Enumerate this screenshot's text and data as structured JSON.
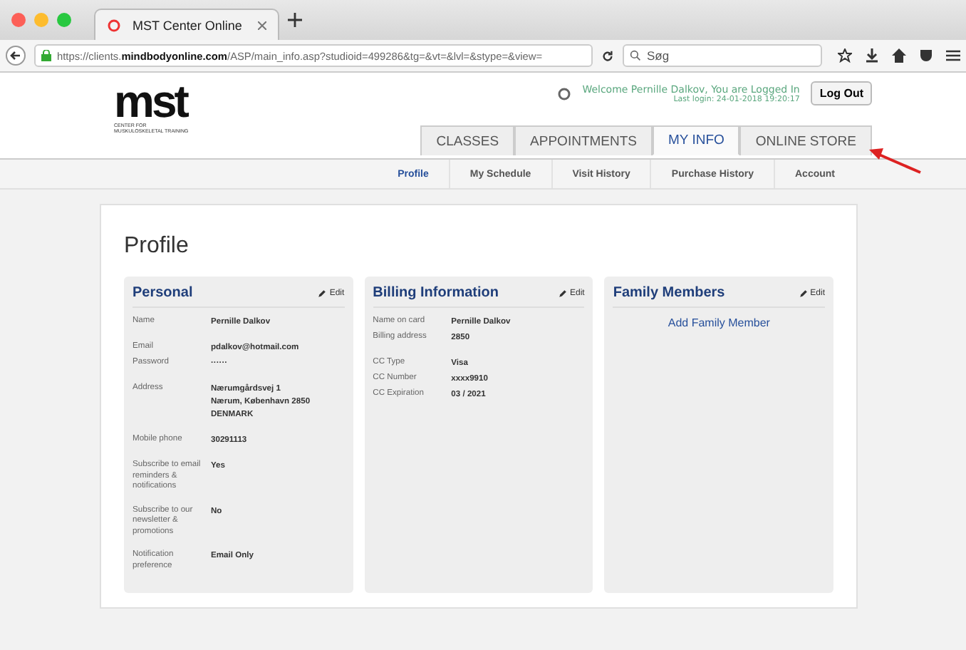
{
  "browser": {
    "tab_title": "MST Center Online",
    "url": "https://clients.**mindbodyonline.com**/ASP/main_info.asp?studioid=499286&tg=&vt=&lvl=&stype=&view=",
    "search_placeholder": "Søg"
  },
  "logo": {
    "mark": "mst",
    "line_1": "CENTER FOR",
    "line_2": "MUSKULOSKELETAL TRAINING"
  },
  "welcome": {
    "text": "Welcome Pernille Dalkov, You are Logged In",
    "last_login": "Last login: 24-01-2018 19:20:17",
    "logout": "Log Out"
  },
  "tabs": [
    {
      "label": "CLASSES",
      "selected": false
    },
    {
      "label": "APPOINTMENTS",
      "selected": false
    },
    {
      "label": "MY INFO",
      "selected": true
    },
    {
      "label": "ONLINE STORE",
      "selected": false
    }
  ],
  "subnav": [
    {
      "label": "Profile",
      "selected": true
    },
    {
      "label": "My Schedule",
      "selected": false
    },
    {
      "label": "Visit History",
      "selected": false
    },
    {
      "label": "Purchase History",
      "selected": false
    },
    {
      "label": "Account",
      "selected": false
    }
  ],
  "page_title": "Profile",
  "panels": [
    {
      "title": "Personal",
      "edit": "Edit",
      "groups": [
        [
          {
            "label": "Name",
            "value": [
              "Pernille Dalkov"
            ]
          }
        ],
        [
          {
            "label": "Email",
            "value": [
              "pdalkov@hotmail.com"
            ]
          },
          {
            "label": "Password",
            "value": [
              "······"
            ]
          }
        ],
        [
          {
            "label": "Address",
            "value": [
              "Nærumgårdsvej 1",
              "Nærum, København 2850",
              "DENMARK"
            ]
          }
        ],
        [
          {
            "label": "Mobile phone",
            "value": [
              "30291113"
            ]
          }
        ],
        [
          {
            "label": "Subscribe to email reminders & notifications",
            "value": [
              "Yes"
            ]
          }
        ],
        [
          {
            "label": "Subscribe to our newsletter & promotions",
            "value": [
              "No"
            ]
          }
        ],
        [
          {
            "label": "Notification preference",
            "value": [
              "Email Only"
            ]
          }
        ]
      ]
    },
    {
      "title": "Billing Information",
      "edit": "Edit",
      "groups": [
        [
          {
            "label": "Name on card",
            "value": [
              "Pernille Dalkov"
            ]
          },
          {
            "label": "Billing address",
            "value": [
              "2850"
            ]
          }
        ],
        [
          {
            "label": "CC Type",
            "value": [
              "Visa"
            ]
          },
          {
            "label": "CC Number",
            "value": [
              "xxxx9910"
            ]
          },
          {
            "label": "CC Expiration",
            "value": [
              "03 / 2021"
            ]
          }
        ]
      ]
    },
    {
      "title": "Family Members",
      "edit": "Edit",
      "link": "Add Family Member"
    }
  ]
}
